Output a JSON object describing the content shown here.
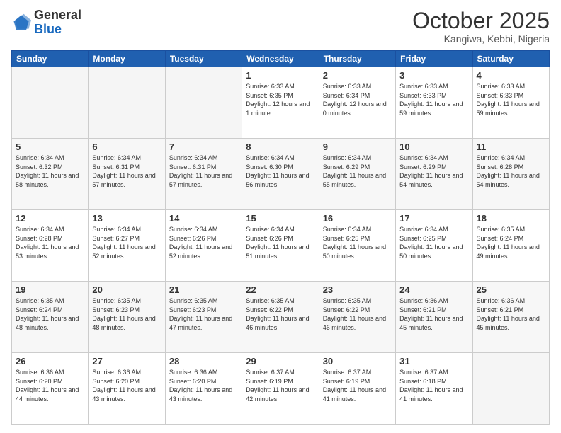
{
  "logo": {
    "general": "General",
    "blue": "Blue"
  },
  "header": {
    "month": "October 2025",
    "location": "Kangiwa, Kebbi, Nigeria"
  },
  "weekdays": [
    "Sunday",
    "Monday",
    "Tuesday",
    "Wednesday",
    "Thursday",
    "Friday",
    "Saturday"
  ],
  "weeks": [
    [
      {
        "day": "",
        "sunrise": "",
        "sunset": "",
        "daylight": ""
      },
      {
        "day": "",
        "sunrise": "",
        "sunset": "",
        "daylight": ""
      },
      {
        "day": "",
        "sunrise": "",
        "sunset": "",
        "daylight": ""
      },
      {
        "day": "1",
        "sunrise": "Sunrise: 6:33 AM",
        "sunset": "Sunset: 6:35 PM",
        "daylight": "Daylight: 12 hours and 1 minute."
      },
      {
        "day": "2",
        "sunrise": "Sunrise: 6:33 AM",
        "sunset": "Sunset: 6:34 PM",
        "daylight": "Daylight: 12 hours and 0 minutes."
      },
      {
        "day": "3",
        "sunrise": "Sunrise: 6:33 AM",
        "sunset": "Sunset: 6:33 PM",
        "daylight": "Daylight: 11 hours and 59 minutes."
      },
      {
        "day": "4",
        "sunrise": "Sunrise: 6:33 AM",
        "sunset": "Sunset: 6:33 PM",
        "daylight": "Daylight: 11 hours and 59 minutes."
      }
    ],
    [
      {
        "day": "5",
        "sunrise": "Sunrise: 6:34 AM",
        "sunset": "Sunset: 6:32 PM",
        "daylight": "Daylight: 11 hours and 58 minutes."
      },
      {
        "day": "6",
        "sunrise": "Sunrise: 6:34 AM",
        "sunset": "Sunset: 6:31 PM",
        "daylight": "Daylight: 11 hours and 57 minutes."
      },
      {
        "day": "7",
        "sunrise": "Sunrise: 6:34 AM",
        "sunset": "Sunset: 6:31 PM",
        "daylight": "Daylight: 11 hours and 57 minutes."
      },
      {
        "day": "8",
        "sunrise": "Sunrise: 6:34 AM",
        "sunset": "Sunset: 6:30 PM",
        "daylight": "Daylight: 11 hours and 56 minutes."
      },
      {
        "day": "9",
        "sunrise": "Sunrise: 6:34 AM",
        "sunset": "Sunset: 6:29 PM",
        "daylight": "Daylight: 11 hours and 55 minutes."
      },
      {
        "day": "10",
        "sunrise": "Sunrise: 6:34 AM",
        "sunset": "Sunset: 6:29 PM",
        "daylight": "Daylight: 11 hours and 54 minutes."
      },
      {
        "day": "11",
        "sunrise": "Sunrise: 6:34 AM",
        "sunset": "Sunset: 6:28 PM",
        "daylight": "Daylight: 11 hours and 54 minutes."
      }
    ],
    [
      {
        "day": "12",
        "sunrise": "Sunrise: 6:34 AM",
        "sunset": "Sunset: 6:28 PM",
        "daylight": "Daylight: 11 hours and 53 minutes."
      },
      {
        "day": "13",
        "sunrise": "Sunrise: 6:34 AM",
        "sunset": "Sunset: 6:27 PM",
        "daylight": "Daylight: 11 hours and 52 minutes."
      },
      {
        "day": "14",
        "sunrise": "Sunrise: 6:34 AM",
        "sunset": "Sunset: 6:26 PM",
        "daylight": "Daylight: 11 hours and 52 minutes."
      },
      {
        "day": "15",
        "sunrise": "Sunrise: 6:34 AM",
        "sunset": "Sunset: 6:26 PM",
        "daylight": "Daylight: 11 hours and 51 minutes."
      },
      {
        "day": "16",
        "sunrise": "Sunrise: 6:34 AM",
        "sunset": "Sunset: 6:25 PM",
        "daylight": "Daylight: 11 hours and 50 minutes."
      },
      {
        "day": "17",
        "sunrise": "Sunrise: 6:34 AM",
        "sunset": "Sunset: 6:25 PM",
        "daylight": "Daylight: 11 hours and 50 minutes."
      },
      {
        "day": "18",
        "sunrise": "Sunrise: 6:35 AM",
        "sunset": "Sunset: 6:24 PM",
        "daylight": "Daylight: 11 hours and 49 minutes."
      }
    ],
    [
      {
        "day": "19",
        "sunrise": "Sunrise: 6:35 AM",
        "sunset": "Sunset: 6:24 PM",
        "daylight": "Daylight: 11 hours and 48 minutes."
      },
      {
        "day": "20",
        "sunrise": "Sunrise: 6:35 AM",
        "sunset": "Sunset: 6:23 PM",
        "daylight": "Daylight: 11 hours and 48 minutes."
      },
      {
        "day": "21",
        "sunrise": "Sunrise: 6:35 AM",
        "sunset": "Sunset: 6:23 PM",
        "daylight": "Daylight: 11 hours and 47 minutes."
      },
      {
        "day": "22",
        "sunrise": "Sunrise: 6:35 AM",
        "sunset": "Sunset: 6:22 PM",
        "daylight": "Daylight: 11 hours and 46 minutes."
      },
      {
        "day": "23",
        "sunrise": "Sunrise: 6:35 AM",
        "sunset": "Sunset: 6:22 PM",
        "daylight": "Daylight: 11 hours and 46 minutes."
      },
      {
        "day": "24",
        "sunrise": "Sunrise: 6:36 AM",
        "sunset": "Sunset: 6:21 PM",
        "daylight": "Daylight: 11 hours and 45 minutes."
      },
      {
        "day": "25",
        "sunrise": "Sunrise: 6:36 AM",
        "sunset": "Sunset: 6:21 PM",
        "daylight": "Daylight: 11 hours and 45 minutes."
      }
    ],
    [
      {
        "day": "26",
        "sunrise": "Sunrise: 6:36 AM",
        "sunset": "Sunset: 6:20 PM",
        "daylight": "Daylight: 11 hours and 44 minutes."
      },
      {
        "day": "27",
        "sunrise": "Sunrise: 6:36 AM",
        "sunset": "Sunset: 6:20 PM",
        "daylight": "Daylight: 11 hours and 43 minutes."
      },
      {
        "day": "28",
        "sunrise": "Sunrise: 6:36 AM",
        "sunset": "Sunset: 6:20 PM",
        "daylight": "Daylight: 11 hours and 43 minutes."
      },
      {
        "day": "29",
        "sunrise": "Sunrise: 6:37 AM",
        "sunset": "Sunset: 6:19 PM",
        "daylight": "Daylight: 11 hours and 42 minutes."
      },
      {
        "day": "30",
        "sunrise": "Sunrise: 6:37 AM",
        "sunset": "Sunset: 6:19 PM",
        "daylight": "Daylight: 11 hours and 41 minutes."
      },
      {
        "day": "31",
        "sunrise": "Sunrise: 6:37 AM",
        "sunset": "Sunset: 6:18 PM",
        "daylight": "Daylight: 11 hours and 41 minutes."
      },
      {
        "day": "",
        "sunrise": "",
        "sunset": "",
        "daylight": ""
      }
    ]
  ]
}
